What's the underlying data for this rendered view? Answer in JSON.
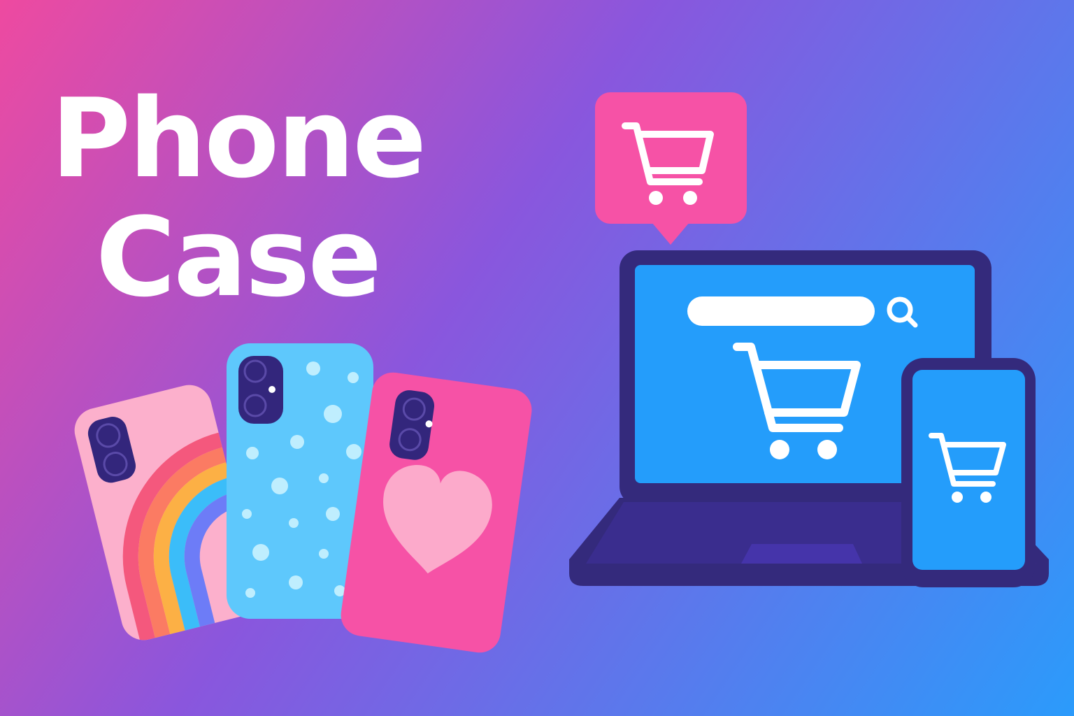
{
  "headline": {
    "line1": "Phone",
    "line2": "Case"
  },
  "colors": {
    "background_from": "#ee4aa0",
    "background_mid": "#8a56dd",
    "background_to": "#2b9bfb",
    "rainbow_case": "#fcb0cc",
    "dots_case": "#5ec8fc",
    "heart_case": "#f652a6",
    "heart": "#fcaacb",
    "camera": "#33267c",
    "laptop_frame": "#342a7c",
    "screen": "#249dfb",
    "cart_bubble": "#f652a6",
    "icon": "#ffffff"
  },
  "icons": {
    "bubble": "shopping-cart-icon",
    "search": "magnifier-icon",
    "laptop_cart": "shopping-cart-icon",
    "phone_cart": "shopping-cart-icon"
  }
}
